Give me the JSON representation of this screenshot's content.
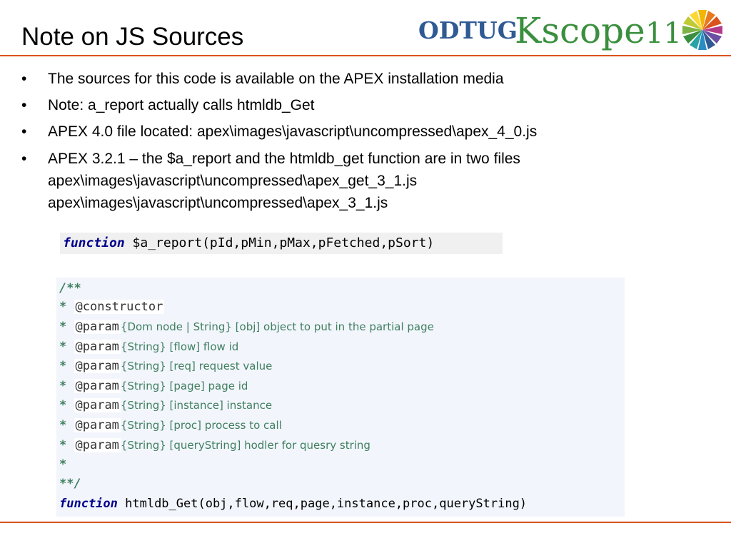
{
  "slide": {
    "title": "Note on JS Sources"
  },
  "logo": {
    "org": "ODTUG",
    "event": "Kscope",
    "year": "11"
  },
  "colors": {
    "accent_rule": "#d9531e",
    "logo_odtug": "#2f5a94",
    "logo_kscope": "#3a8f3e",
    "code_keyword": "#00008b",
    "code_comment": "#3f7f5f"
  },
  "bullet_glyph": "•",
  "bullets": [
    {
      "text": "The sources for this code is available on the APEX installation media"
    },
    {
      "text": "Note: a_report actually calls htmldb_Get"
    },
    {
      "text": "APEX 4.0 file located: apex\\images\\javascript\\uncompressed\\apex_4_0.js"
    },
    {
      "text": "APEX 3.2.1 – the $a_report and the htmldb_get function are in two files",
      "sublines": [
        "apex\\images\\javascript\\uncompressed\\apex_get_3_1.js",
        "apex\\images\\javascript\\uncompressed\\apex_3_1.js"
      ]
    }
  ],
  "code_signature": {
    "keyword": "function",
    "rest": " $a_report(pId,pMin,pMax,pFetched,pSort)"
  },
  "code_block": {
    "open": "/**",
    "constructor_tag": "@constructor",
    "param_tag": "@param",
    "star": "*",
    "params": [
      "{Dom node | String} [obj] object to put in the partial page",
      "{String} [flow] flow id",
      "{String} [req] request value",
      "{String} [page] page id",
      "{String} [instance] instance",
      "{String} [proc] process to call",
      "{String} [queryString] hodler for quesry string"
    ],
    "blank_star": "*",
    "close": "**/",
    "fn_keyword": "function",
    "fn_rest": " htmldb_Get(obj,flow,req,page,instance,proc,queryString)"
  }
}
